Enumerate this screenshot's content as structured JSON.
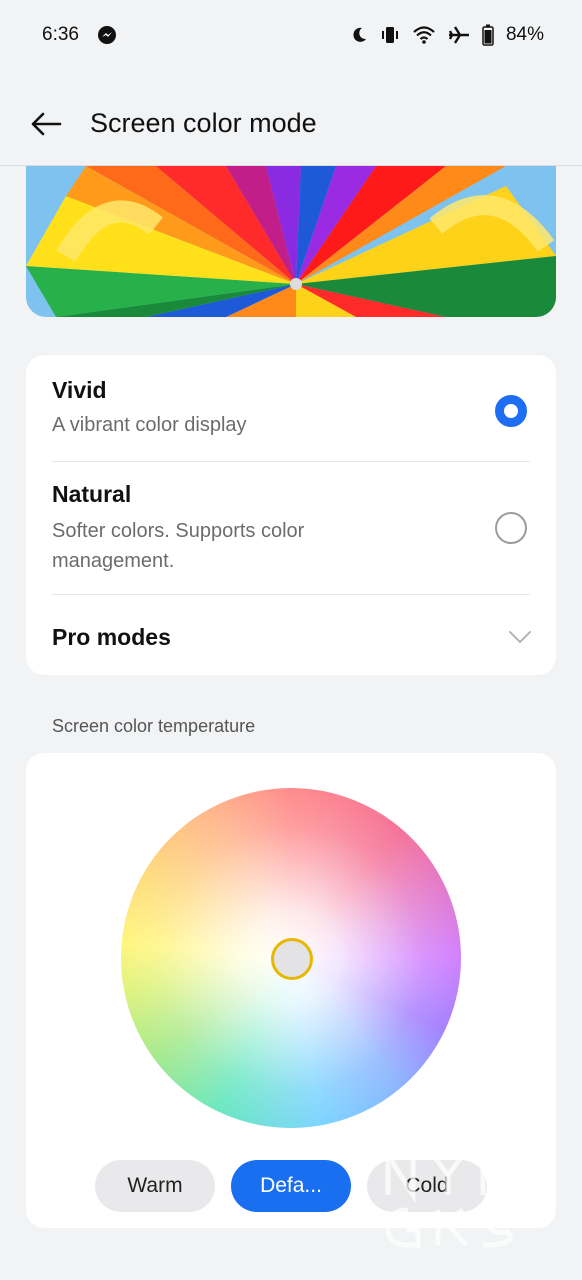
{
  "status_bar": {
    "time": "6:36",
    "battery_percent": "84%",
    "icons": [
      "messenger-icon",
      "moon-icon",
      "vibrate-icon",
      "wifi-icon",
      "airplane-icon",
      "battery-icon"
    ]
  },
  "header": {
    "title": "Screen color mode",
    "back_icon": "back-arrow-icon"
  },
  "modes": [
    {
      "title": "Vivid",
      "subtitle": "A vibrant color display",
      "selected": true
    },
    {
      "title": "Natural",
      "subtitle_line1": "Softer colors. Supports color",
      "subtitle_line2": "management.",
      "selected": false
    }
  ],
  "pro_modes": {
    "label": "Pro modes",
    "icon": "chevron-down-icon"
  },
  "temperature": {
    "section_label": "Screen color temperature",
    "buttons": [
      {
        "label": "Warm",
        "selected": false
      },
      {
        "label": "Defa...",
        "selected": true
      },
      {
        "label": "Cold",
        "selected": false
      }
    ]
  },
  "colors": {
    "accent": "#1d6ef2",
    "background": "#f2f3f5",
    "card": "#ffffff",
    "handle_ring": "#e8b800"
  }
}
